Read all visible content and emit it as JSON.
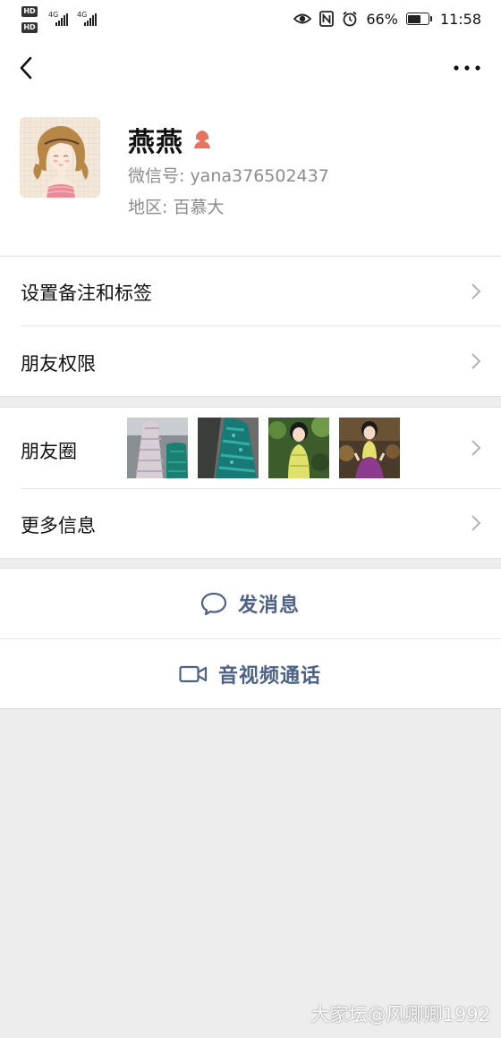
{
  "status_bar": {
    "hd_label": "HD",
    "network_label": "4G",
    "battery_percent": "66%",
    "time": "11:58",
    "battery_level": 0.66,
    "icons": [
      "eye-comfort-icon",
      "nfc-icon",
      "alarm-icon",
      "battery-icon"
    ]
  },
  "nav": {
    "back_icon": "back-chevron-icon",
    "more_icon": "more-dots-icon"
  },
  "profile": {
    "name": "燕燕",
    "gender_icon": "female-gender-icon",
    "wechat_id": "微信号: yana376502437",
    "region": "地区: 百慕大"
  },
  "settings": {
    "items": [
      {
        "label": "设置备注和标签"
      },
      {
        "label": "朋友权限"
      }
    ]
  },
  "moments": {
    "label": "朋友圈",
    "thumb_count": 4
  },
  "more_info": {
    "label": "更多信息"
  },
  "actions": {
    "message": "发消息",
    "video_call": "音视频通话"
  },
  "colors": {
    "accent_text": "#4d6285",
    "background": "#ededed",
    "gender_icon": "#e7735e"
  },
  "watermark": "大家坛@风卿卿1992"
}
